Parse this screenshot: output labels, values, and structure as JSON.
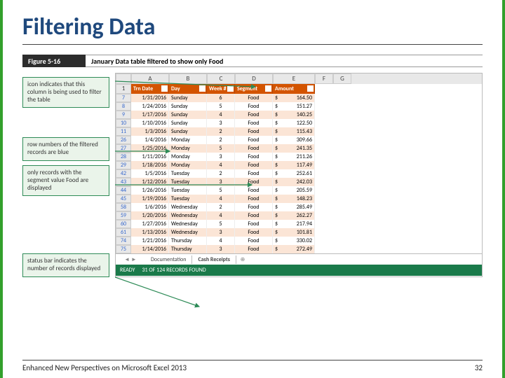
{
  "title": "Filtering Data",
  "figure": {
    "label": "Figure 5-16",
    "caption": "January Data table filtered to show only Food"
  },
  "annotations": {
    "a1": "icon indicates that this column is being used to filter the table",
    "a2": "row numbers of the filtered records are blue",
    "a3": "only records with the segment value Food are displayed",
    "a4": "status bar indicates the number of records displayed"
  },
  "columns": {
    "A": "A",
    "B": "B",
    "C": "C",
    "D": "D",
    "E": "E",
    "F": "F",
    "G": "G"
  },
  "headers": {
    "rownum": "1",
    "c1": "Trn Date",
    "c2": "Day",
    "c3": "Week #",
    "c4": "Segment",
    "c5": "Amount"
  },
  "rows": [
    {
      "n": "7",
      "date": "1/31/2016",
      "day": "Sunday",
      "wk": "6",
      "seg": "Food",
      "cur": "$",
      "amt": "164.50"
    },
    {
      "n": "8",
      "date": "1/24/2016",
      "day": "Sunday",
      "wk": "5",
      "seg": "Food",
      "cur": "$",
      "amt": "151.27"
    },
    {
      "n": "9",
      "date": "1/17/2016",
      "day": "Sunday",
      "wk": "4",
      "seg": "Food",
      "cur": "$",
      "amt": "140.25"
    },
    {
      "n": "10",
      "date": "1/10/2016",
      "day": "Sunday",
      "wk": "3",
      "seg": "Food",
      "cur": "$",
      "amt": "122.50"
    },
    {
      "n": "11",
      "date": "1/3/2016",
      "day": "Sunday",
      "wk": "2",
      "seg": "Food",
      "cur": "$",
      "amt": "115.43"
    },
    {
      "n": "26",
      "date": "1/4/2016",
      "day": "Monday",
      "wk": "2",
      "seg": "Food",
      "cur": "$",
      "amt": "309.66"
    },
    {
      "n": "27",
      "date": "1/25/2016",
      "day": "Monday",
      "wk": "5",
      "seg": "Food",
      "cur": "$",
      "amt": "241.35"
    },
    {
      "n": "28",
      "date": "1/11/2016",
      "day": "Monday",
      "wk": "3",
      "seg": "Food",
      "cur": "$",
      "amt": "211.26"
    },
    {
      "n": "29",
      "date": "1/18/2016",
      "day": "Monday",
      "wk": "4",
      "seg": "Food",
      "cur": "$",
      "amt": "117.49"
    },
    {
      "n": "42",
      "date": "1/5/2016",
      "day": "Tuesday",
      "wk": "2",
      "seg": "Food",
      "cur": "$",
      "amt": "252.61"
    },
    {
      "n": "43",
      "date": "1/12/2016",
      "day": "Tuesday",
      "wk": "3",
      "seg": "Food",
      "cur": "$",
      "amt": "242.03"
    },
    {
      "n": "44",
      "date": "1/26/2016",
      "day": "Tuesday",
      "wk": "5",
      "seg": "Food",
      "cur": "$",
      "amt": "205.59"
    },
    {
      "n": "45",
      "date": "1/19/2016",
      "day": "Tuesday",
      "wk": "4",
      "seg": "Food",
      "cur": "$",
      "amt": "148.23"
    },
    {
      "n": "58",
      "date": "1/6/2016",
      "day": "Wednesday",
      "wk": "2",
      "seg": "Food",
      "cur": "$",
      "amt": "285.49"
    },
    {
      "n": "59",
      "date": "1/20/2016",
      "day": "Wednesday",
      "wk": "4",
      "seg": "Food",
      "cur": "$",
      "amt": "262.27"
    },
    {
      "n": "60",
      "date": "1/27/2016",
      "day": "Wednesday",
      "wk": "5",
      "seg": "Food",
      "cur": "$",
      "amt": "217.94"
    },
    {
      "n": "61",
      "date": "1/13/2016",
      "day": "Wednesday",
      "wk": "3",
      "seg": "Food",
      "cur": "$",
      "amt": "101.81"
    },
    {
      "n": "74",
      "date": "1/21/2016",
      "day": "Thursday",
      "wk": "4",
      "seg": "Food",
      "cur": "$",
      "amt": "330.02"
    },
    {
      "n": "75",
      "date": "1/14/2016",
      "day": "Thursday",
      "wk": "3",
      "seg": "Food",
      "cur": "$",
      "amt": "272.49"
    }
  ],
  "tabs": {
    "nav": "◄ ►",
    "t1": "Documentation",
    "t2": "Cash Receipts",
    "plus": "⊕"
  },
  "status": {
    "ready": "READY",
    "count": "31 OF 124 RECORDS FOUND"
  },
  "footer": {
    "left": "Enhanced New Perspectives on Microsoft Excel 2013",
    "right": "32"
  }
}
